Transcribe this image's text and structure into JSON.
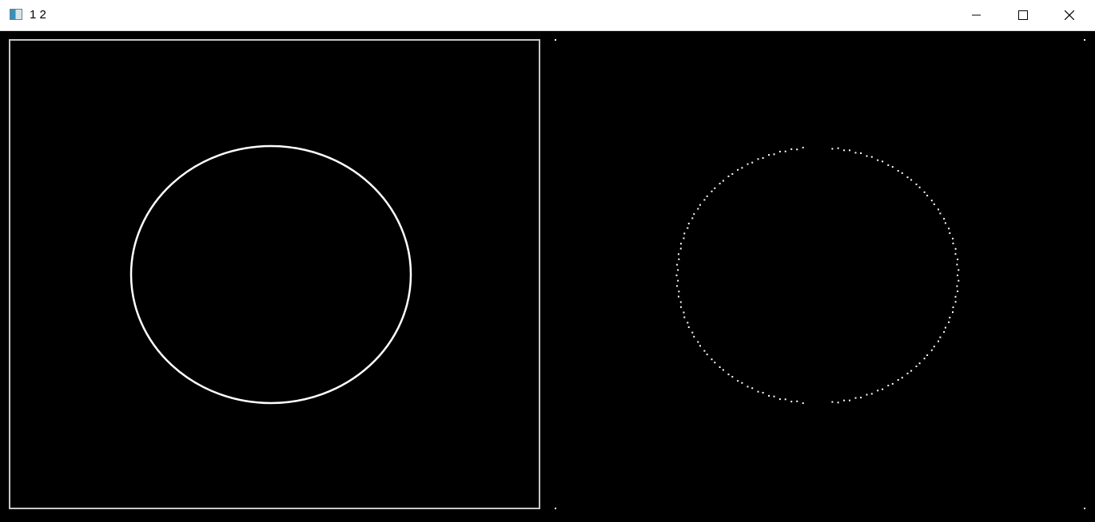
{
  "window": {
    "title": "1 2",
    "controls": {
      "minimize": "minimize-icon",
      "maximize": "maximize-icon",
      "close": "close-icon"
    }
  },
  "panels": [
    {
      "name": "image-1",
      "content": "solid-ellipse-with-border",
      "stroke_color": "#ffffff",
      "border_color": "#c8c8c8"
    },
    {
      "name": "image-2",
      "content": "dotted-ellipse",
      "stroke_color": "#ffffff"
    }
  ],
  "colors": {
    "background": "#000000",
    "titlebar": "#ffffff"
  }
}
